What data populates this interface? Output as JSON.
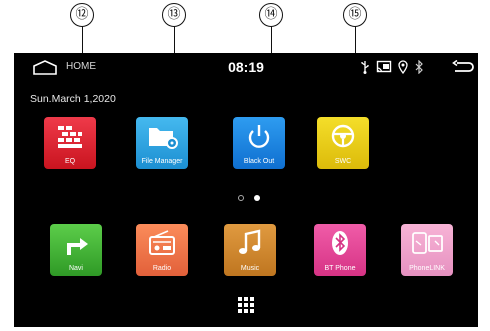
{
  "callouts": [
    "⑫",
    "⑬",
    "⑭",
    "⑮"
  ],
  "statusbar": {
    "home_label": "HOME",
    "time": "08:19"
  },
  "date": "Sun.March 1,2020",
  "apps": {
    "eq": "EQ",
    "file_manager": "File Manager",
    "black_out": "Black Out",
    "swc": "SWC",
    "navi": "Navi",
    "radio": "Radio",
    "music": "Music",
    "bt_phone": "BT Phone",
    "phonelink": "PhoneLINK"
  },
  "icons": [
    "home-icon",
    "usb-icon",
    "screen-cast-icon",
    "location-icon",
    "bluetooth-icon",
    "back-icon",
    "equalizer-icon",
    "folder-gear-icon",
    "power-icon",
    "steering-wheel-icon",
    "navigation-arrow-icon",
    "radio-icon",
    "music-note-icon",
    "bluetooth-phone-icon",
    "phone-link-icon",
    "app-grid-icon"
  ],
  "pager": {
    "pages": 2,
    "current": 2
  }
}
